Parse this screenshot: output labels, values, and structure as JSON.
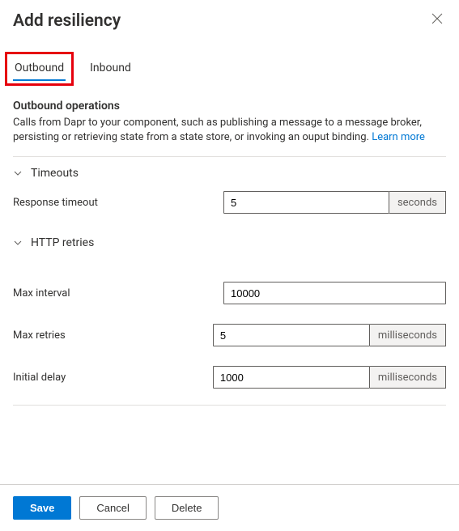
{
  "header": {
    "title": "Add resiliency"
  },
  "tabs": {
    "outbound": "Outbound",
    "inbound": "Inbound"
  },
  "section": {
    "title": "Outbound operations",
    "desc_prefix": "Calls from Dapr to your component, such as publishing a message to a message broker, persisting or retrieving state from a state store, or invoking an ouput binding. ",
    "learn_more": "Learn more"
  },
  "groups": {
    "timeouts": {
      "label": "Timeouts",
      "response_timeout_label": "Response timeout",
      "response_timeout_value": "5",
      "response_timeout_unit": "seconds"
    },
    "http_retries": {
      "label": "HTTP retries",
      "max_interval_label": "Max interval",
      "max_interval_value": "10000",
      "max_retries_label": "Max retries",
      "max_retries_value": "5",
      "max_retries_unit": "milliseconds",
      "initial_delay_label": "Initial delay",
      "initial_delay_value": "1000",
      "initial_delay_unit": "milliseconds"
    }
  },
  "footer": {
    "save": "Save",
    "cancel": "Cancel",
    "delete": "Delete"
  }
}
